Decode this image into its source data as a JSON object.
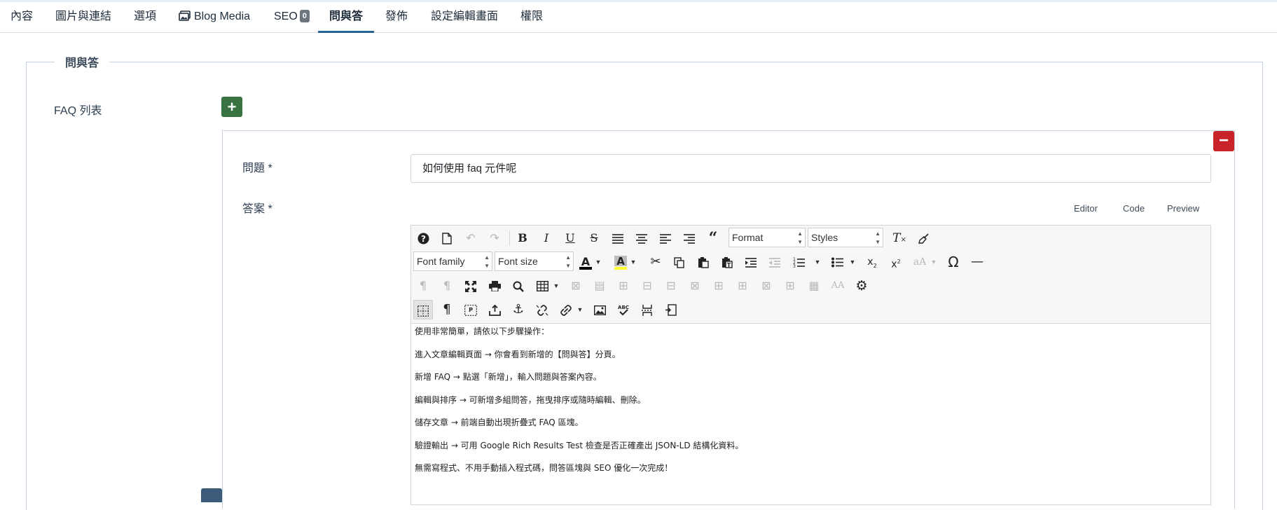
{
  "tabs": [
    {
      "label": "內容"
    },
    {
      "label": "圖片與連結"
    },
    {
      "label": "選項"
    },
    {
      "label": "Blog Media",
      "icon": "images-icon"
    },
    {
      "label": "SEO",
      "badge": "0"
    },
    {
      "label": "問與答",
      "active": true
    },
    {
      "label": "發佈"
    },
    {
      "label": "設定編輯畫面"
    },
    {
      "label": "權限"
    }
  ],
  "fieldset": {
    "legend": "問與答"
  },
  "faq": {
    "list_label": "FAQ 列表",
    "add_button": "+",
    "remove_button": "−",
    "question_label": "問題 *",
    "question_value": "如何使用 faq 元件呢",
    "answer_label": "答案 *"
  },
  "editor": {
    "modes": [
      "Editor",
      "Code",
      "Preview"
    ],
    "format_select": "Format",
    "styles_select": "Styles",
    "font_family_select": "Font family",
    "font_size_select": "Font size",
    "content": [
      "使用非常簡單，請依以下步驟操作：",
      "進入文章編輯頁面 → 你會看到新增的【問與答】分頁。",
      "新增 FAQ → 點選「新增」，輸入問題與答案內容。",
      "編輯與排序 → 可新增多組問答，拖曳排序或隨時編輯、刪除。",
      "儲存文章 → 前端自動出現折疊式 FAQ 區塊。",
      "驗證輸出 → 可用 Google Rich Results Test 檢查是否正確產出 JSON-LD 結構化資料。",
      "無需寫程式、不用手動插入程式碼，問答區塊與 SEO 優化一次完成！"
    ]
  },
  "colors": {
    "add_button": "#3a7342",
    "remove_button": "#c9232a",
    "active_tab_underline": "#2a6496",
    "badge": "#6c757d"
  }
}
